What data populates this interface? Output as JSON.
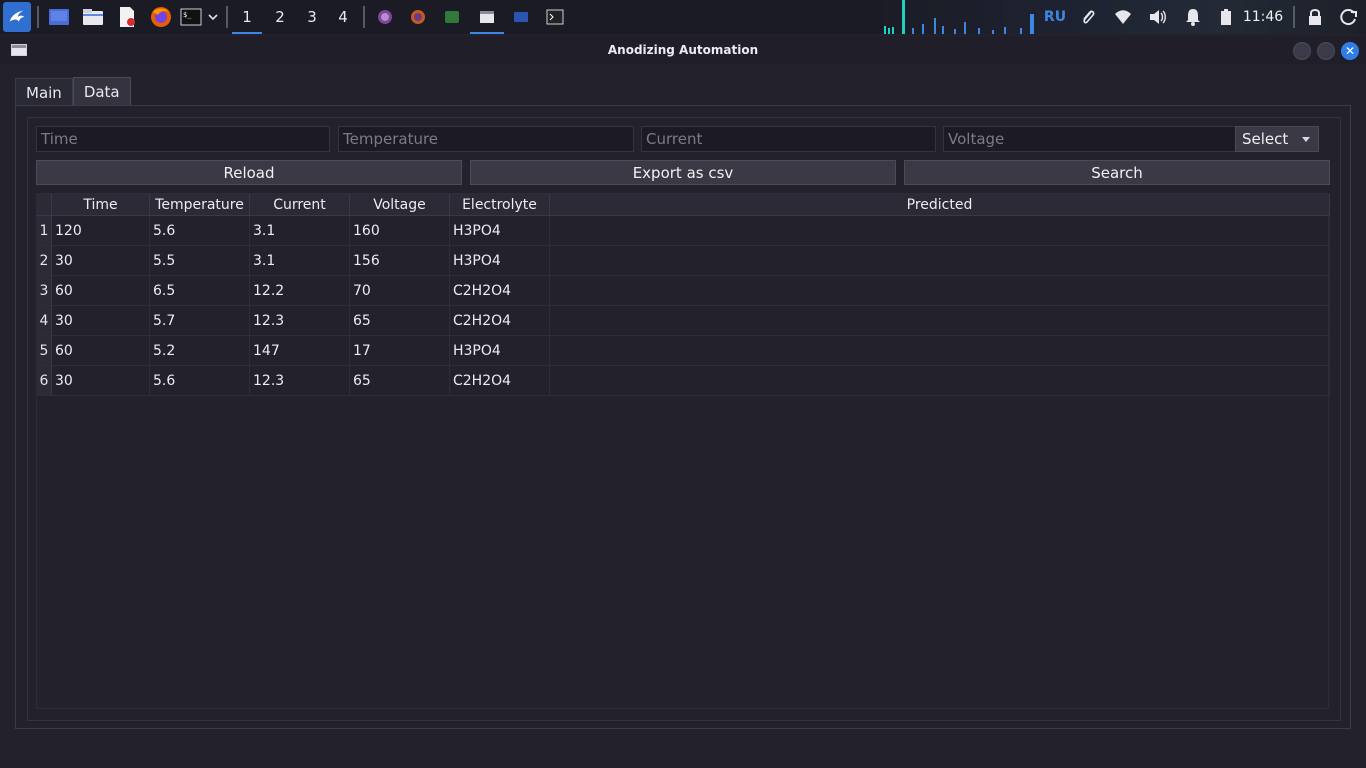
{
  "taskbar": {
    "workspaces": [
      "1",
      "2",
      "3",
      "4"
    ],
    "active_workspace": "1",
    "language": "RU",
    "clock": "11:46"
  },
  "window": {
    "title": "Anodizing Automation"
  },
  "tabs": [
    {
      "label": "Main",
      "active": false
    },
    {
      "label": "Data",
      "active": true
    }
  ],
  "filters": {
    "time_placeholder": "Time",
    "temperature_placeholder": "Temperature",
    "current_placeholder": "Current",
    "voltage_placeholder": "Voltage",
    "select_value": "Select"
  },
  "buttons": {
    "reload": "Reload",
    "export": "Export as csv",
    "search": "Search"
  },
  "table": {
    "columns": [
      "Time",
      "Temperature",
      "Current",
      "Voltage",
      "Electrolyte",
      "Predicted"
    ],
    "rows": [
      {
        "index": "1",
        "time": "120",
        "temperature": "5.6",
        "current": "3.1",
        "voltage": "160",
        "electrolyte": "H3PO4",
        "predicted": ""
      },
      {
        "index": "2",
        "time": "30",
        "temperature": "5.5",
        "current": "3.1",
        "voltage": "156",
        "electrolyte": "H3PO4",
        "predicted": ""
      },
      {
        "index": "3",
        "time": "60",
        "temperature": "6.5",
        "current": "12.2",
        "voltage": "70",
        "electrolyte": "C2H2O4",
        "predicted": ""
      },
      {
        "index": "4",
        "time": "30",
        "temperature": "5.7",
        "current": "12.3",
        "voltage": "65",
        "electrolyte": "C2H2O4",
        "predicted": ""
      },
      {
        "index": "5",
        "time": "60",
        "temperature": "5.2",
        "current": "147",
        "voltage": "17",
        "electrolyte": "H3PO4",
        "predicted": ""
      },
      {
        "index": "6",
        "time": "30",
        "temperature": "5.6",
        "current": "12.3",
        "voltage": "65",
        "electrolyte": "C2H2O4",
        "predicted": ""
      }
    ]
  },
  "colors": {
    "accent": "#3d86e6",
    "background": "#22212c",
    "panel": "#1a1b24"
  }
}
